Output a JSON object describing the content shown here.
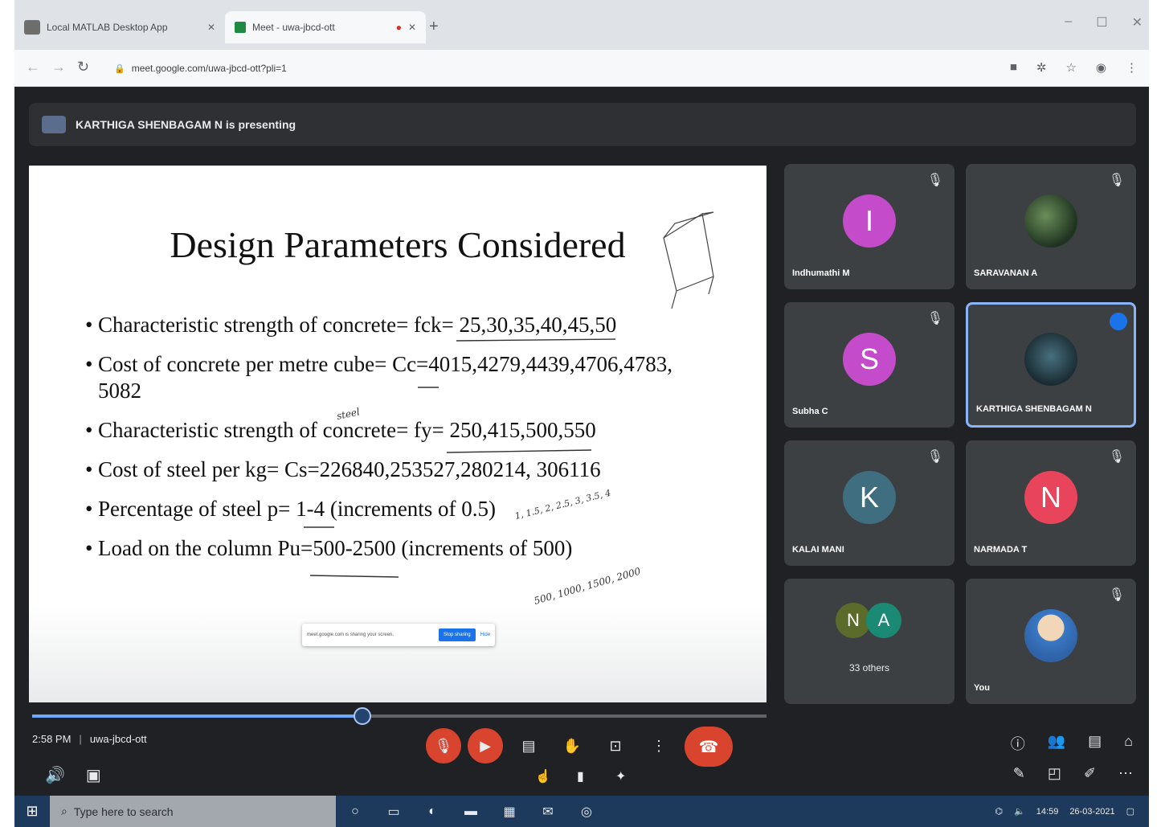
{
  "browser": {
    "tabs": [
      {
        "title": "Local MATLAB Desktop App"
      },
      {
        "title": "Meet - uwa-jbcd-ott",
        "indicator": "●"
      }
    ],
    "new_tab": "+",
    "window_controls": [
      "–",
      "☐",
      "✕"
    ],
    "url": "meet.google.com/uwa-jbcd-ott?pli=1"
  },
  "meet": {
    "presenting_banner": "KARTHIGA SHENBAGAM N is presenting",
    "slide": {
      "title": "Design Parameters Considered",
      "bullets": [
        "Characteristic strength of concrete= fck= 25,30,35,40,45,50",
        "Cost of concrete per metre cube= Cc=4015,4279,4439,4706,4783, 5082",
        "Characteristic strength of concrete= fy= 250,415,500,550",
        "Cost of steel per kg= Cs=226840,253527,280214, 306116",
        "Percentage of steel p= 1-4 (increments of 0.5)",
        "Load on the column Pu=500-2500 (increments of 500)"
      ],
      "annotations": {
        "steel": "steel",
        "percent_list": "1, 1.5, 2, 2.5, 3, 3.5, 4",
        "load_list": "500, 1000, 1500, 2000"
      },
      "share_notice": {
        "text": "meet.google.com is sharing your screen.",
        "stop_button": "Stop sharing",
        "hide_link": "Hide"
      }
    },
    "progress_fraction": 0.45,
    "participants": [
      {
        "name": "Indhumathi M",
        "initial": "I",
        "color": "#c44bc9",
        "mic": "🎙"
      },
      {
        "name": "SARAVANAN A",
        "initial": "",
        "color": "",
        "mic": "🎙"
      },
      {
        "name": "Subha C",
        "initial": "S",
        "color": "#c44bc9",
        "mic": "🎙"
      },
      {
        "name": "KARTHIGA SHENBAGAM N",
        "initial": "",
        "color": "",
        "mic": ""
      },
      {
        "name": "KALAI MANI",
        "initial": "K",
        "color": "#3f6e80",
        "mic": "🎙"
      },
      {
        "name": "NARMADA T",
        "initial": "N",
        "color": "#e8455c",
        "mic": "🎙"
      },
      {
        "name": "",
        "initial": "",
        "color": "",
        "mic": ""
      },
      {
        "name": "You",
        "initial": "",
        "color": "",
        "mic": "🎙"
      }
    ],
    "others_tile": {
      "label": "33 others",
      "initials": [
        "N",
        "A"
      ],
      "colors": [
        "#5b6b2a",
        "#1a8a74"
      ]
    },
    "info": {
      "time": "2:58 PM",
      "separator": "|",
      "code": "uwa-jbcd-ott"
    }
  },
  "taskbar": {
    "search_placeholder": "Type here to search",
    "tray_time": "14:59",
    "tray_date": "26-03-2021"
  }
}
